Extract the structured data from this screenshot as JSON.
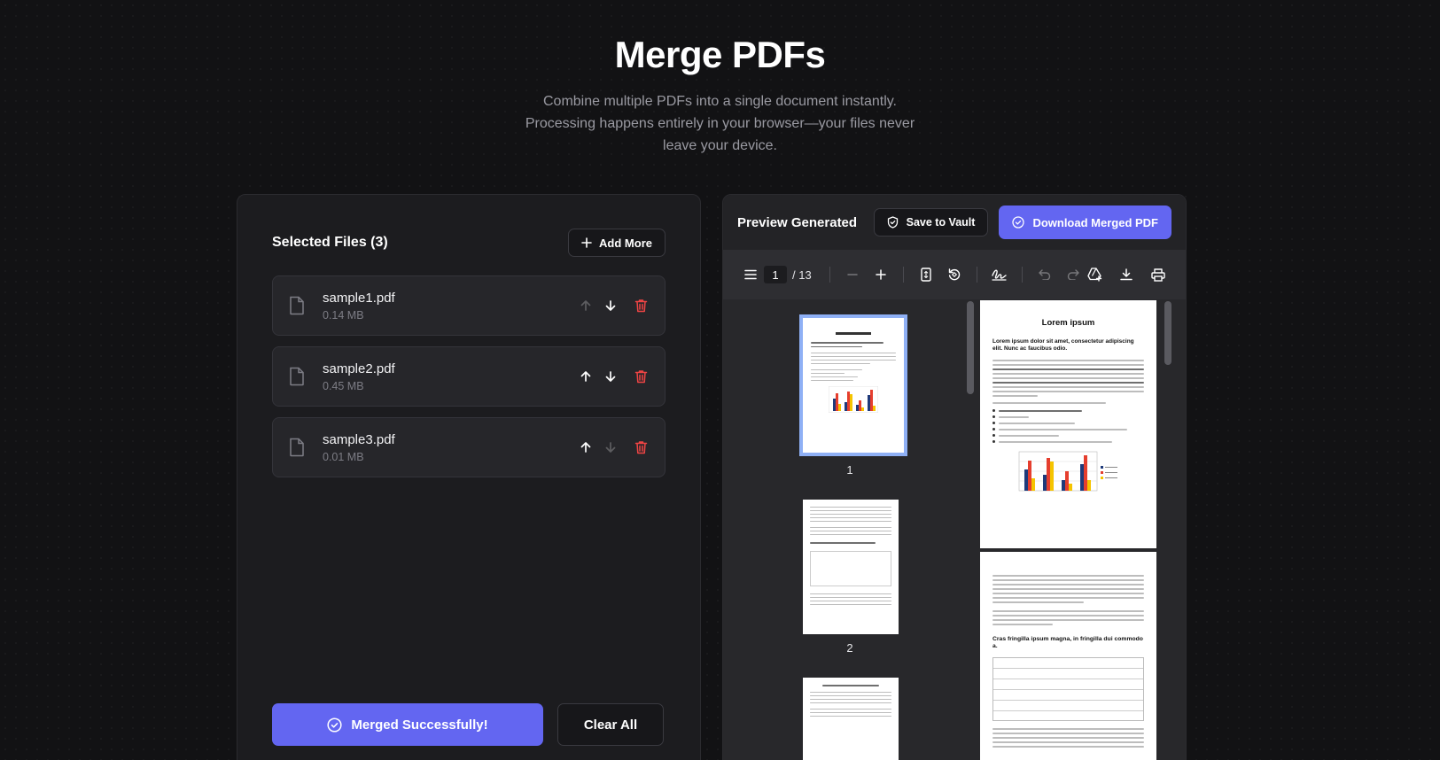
{
  "hero": {
    "title": "Merge PDFs",
    "subtitle": "Combine multiple PDFs into a single document instantly. Processing happens entirely in your browser—your files never leave your device."
  },
  "files_panel": {
    "heading": "Selected Files (3)",
    "add_more_label": "Add More",
    "files": [
      {
        "name": "sample1.pdf",
        "size": "0.14 MB"
      },
      {
        "name": "sample2.pdf",
        "size": "0.45 MB"
      },
      {
        "name": "sample3.pdf",
        "size": "0.01 MB"
      }
    ],
    "merge_status_label": "Merged Successfully!",
    "clear_all_label": "Clear All"
  },
  "preview_panel": {
    "heading": "Preview Generated",
    "save_vault_label": "Save to Vault",
    "download_label": "Download Merged PDF",
    "toolbar": {
      "current_page": "1",
      "total_pages": "/ 13"
    },
    "thumbnails": [
      {
        "label": "1"
      },
      {
        "label": "2"
      }
    ],
    "page1": {
      "title": "Lorem ipsum",
      "subtitle": "Lorem ipsum dolor sit amet, consectetur adipiscing elit. Nunc ac faucibus odio."
    },
    "page2": {
      "heading": "Cras fringilla ipsum magna, in fringilla dui commodo a."
    }
  },
  "colors": {
    "accent": "#6366f1",
    "danger": "#ef4444",
    "background": "#121214",
    "panel": "#1c1c1f"
  }
}
